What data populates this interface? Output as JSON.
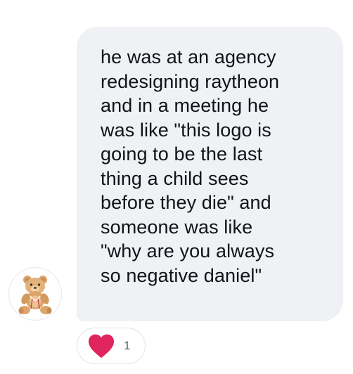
{
  "message": {
    "lines": [
      "he was at an agency",
      "redesigning raytheon",
      "and in a meeting he",
      "was like \"this logo is",
      "going to be the last",
      "thing a child sees",
      "before they die\" and",
      "someone was like",
      "\"why are you always",
      "so negative daniel\""
    ]
  },
  "reaction": {
    "icon": "heart-icon",
    "count": "1",
    "color": "#e0245e"
  },
  "colors": {
    "bubble_bg": "#eff1f5",
    "text": "#0f1419",
    "count_text": "#536471"
  }
}
